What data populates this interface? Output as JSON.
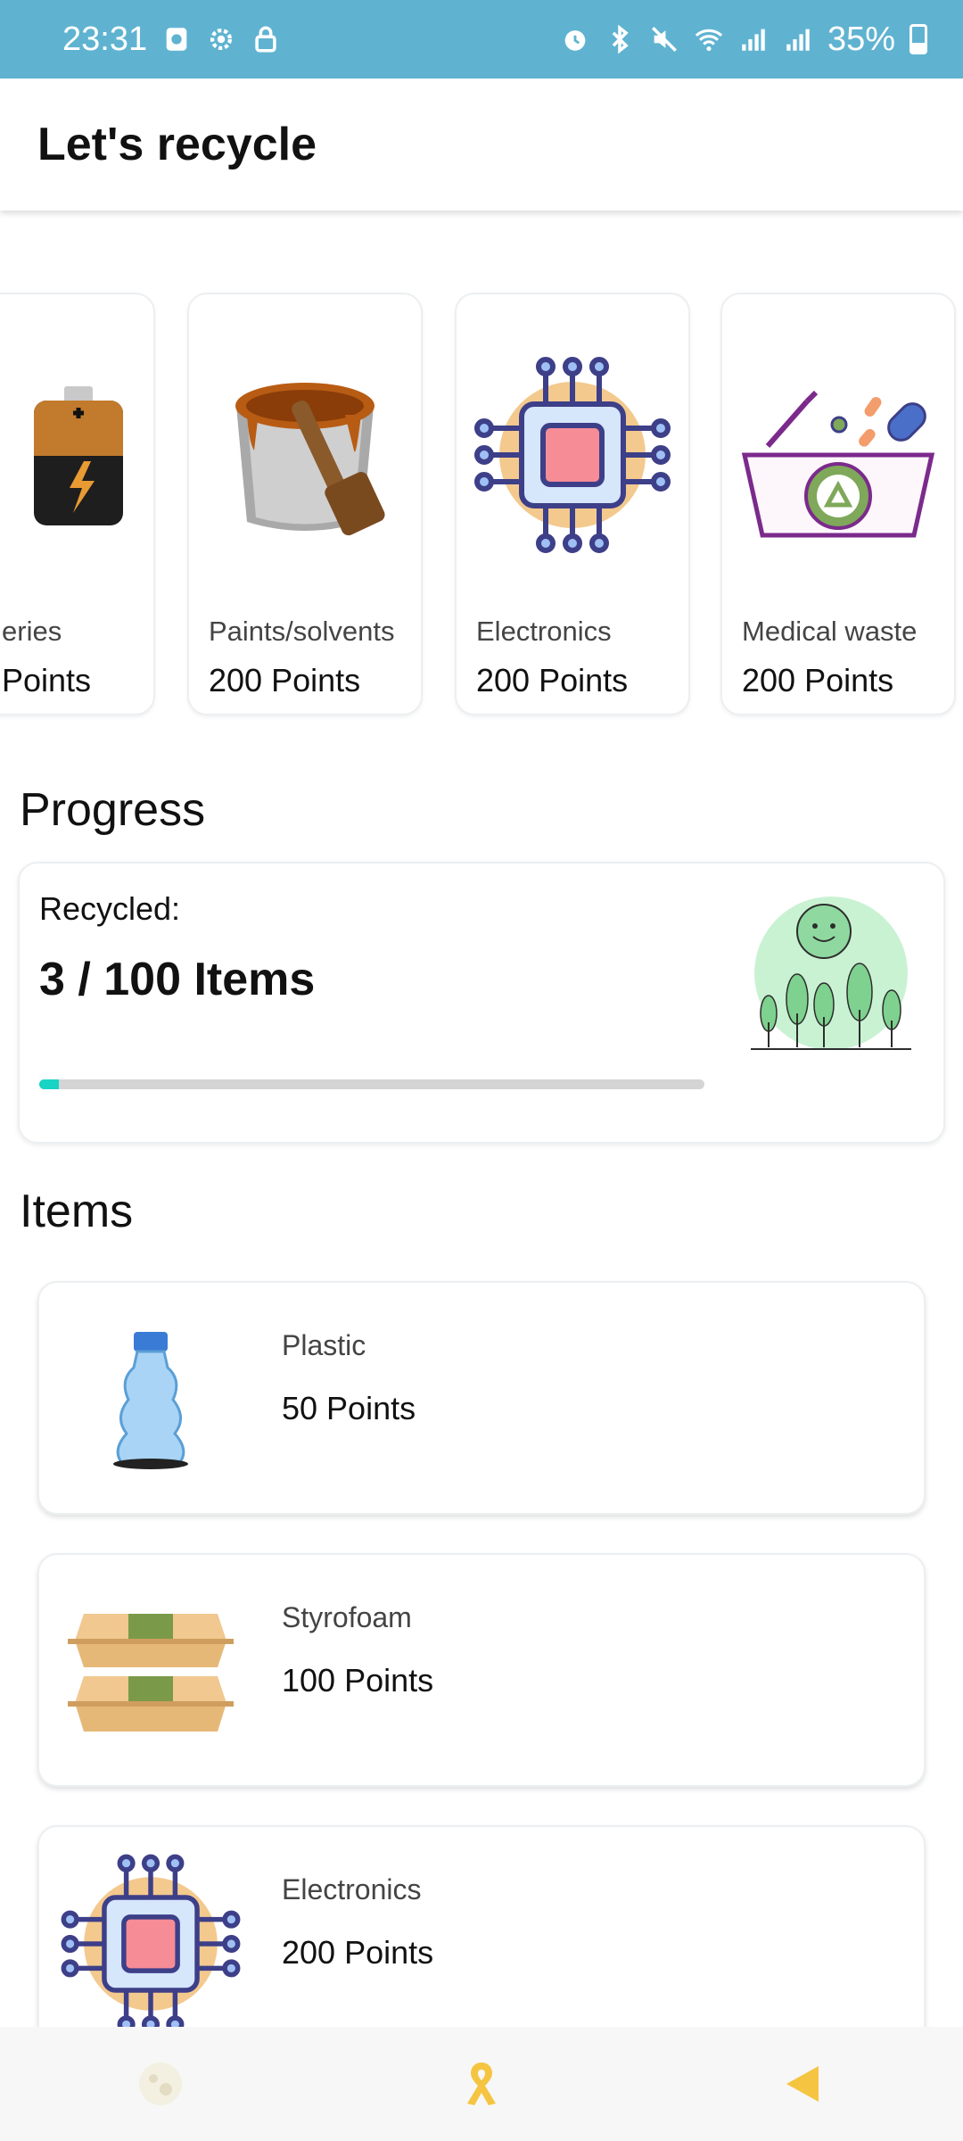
{
  "status_bar": {
    "time": "23:31",
    "battery": "35%",
    "left_icons": [
      "alarm-clock-icon",
      "settings-icon",
      "lock-icon"
    ],
    "right_icons": [
      "alarm-icon",
      "bluetooth-icon",
      "mute-icon",
      "wifi-icon",
      "signal-icon",
      "signal-icon",
      "battery-icon"
    ]
  },
  "app_bar": {
    "title": "Let's recycle"
  },
  "categories": [
    {
      "name": "eries",
      "points": "Points",
      "icon": "battery-image"
    },
    {
      "name": "Paints/solvents",
      "points": "200 Points",
      "icon": "paint-bucket-image"
    },
    {
      "name": "Electronics",
      "points": "200 Points",
      "icon": "microchip-image"
    },
    {
      "name": "Medical waste",
      "points": "200 Points",
      "icon": "medical-waste-image"
    }
  ],
  "progress": {
    "section_title": "Progress",
    "recycled_label": "Recycled:",
    "count_text": "3 / 100 Items",
    "recycled": 3,
    "total": 100,
    "fill_fraction": 0.03
  },
  "items": {
    "section_title": "Items",
    "list": [
      {
        "name": "Plastic",
        "points": "50 Points",
        "icon": "plastic-bottle-image"
      },
      {
        "name": "Styrofoam",
        "points": "100 Points",
        "icon": "styrofoam-box-image"
      },
      {
        "name": "Electronics",
        "points": "200 Points",
        "icon": "microchip-image"
      }
    ]
  },
  "bottom_nav": [
    "moon-icon",
    "ribbon-icon",
    "back-triangle-icon"
  ],
  "colors": {
    "status_bar": "#5fb3d1",
    "progress_fill": "#19d3c5",
    "ribbon": "#f5c542",
    "back": "#f5c542"
  }
}
